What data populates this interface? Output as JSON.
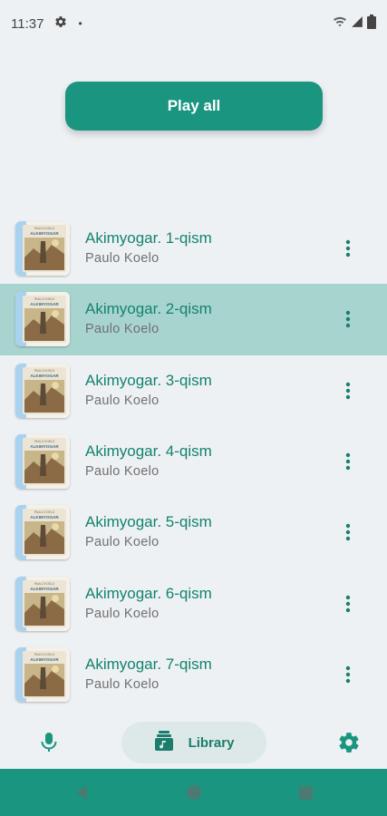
{
  "status_bar": {
    "time": "11:37",
    "dot": "•"
  },
  "play_all_label": "Play all",
  "tracks": [
    {
      "title": "Akimyogar. 1-qism",
      "author": "Paulo Koelo",
      "selected": false
    },
    {
      "title": "Akimyogar. 2-qism",
      "author": "Paulo Koelo",
      "selected": true
    },
    {
      "title": "Akimyogar. 3-qism",
      "author": "Paulo Koelo",
      "selected": false
    },
    {
      "title": "Akimyogar. 4-qism",
      "author": "Paulo Koelo",
      "selected": false
    },
    {
      "title": "Akimyogar. 5-qism",
      "author": "Paulo Koelo",
      "selected": false
    },
    {
      "title": "Akimyogar. 6-qism",
      "author": "Paulo Koelo",
      "selected": false
    },
    {
      "title": "Akimyogar. 7-qism",
      "author": "Paulo Koelo",
      "selected": false
    }
  ],
  "cover_text": {
    "line1": "PAULO KOELO",
    "line2": "ALKIMYOGAR"
  },
  "bottom_nav": {
    "mic_icon": "mic-icon",
    "library_label": "Library",
    "library_icon": "library-icon",
    "settings_icon": "gear-icon"
  },
  "colors": {
    "accent": "#1a9580",
    "title_text": "#13836f",
    "selected_row": "#a8d4cf",
    "background": "#eef1f4"
  }
}
